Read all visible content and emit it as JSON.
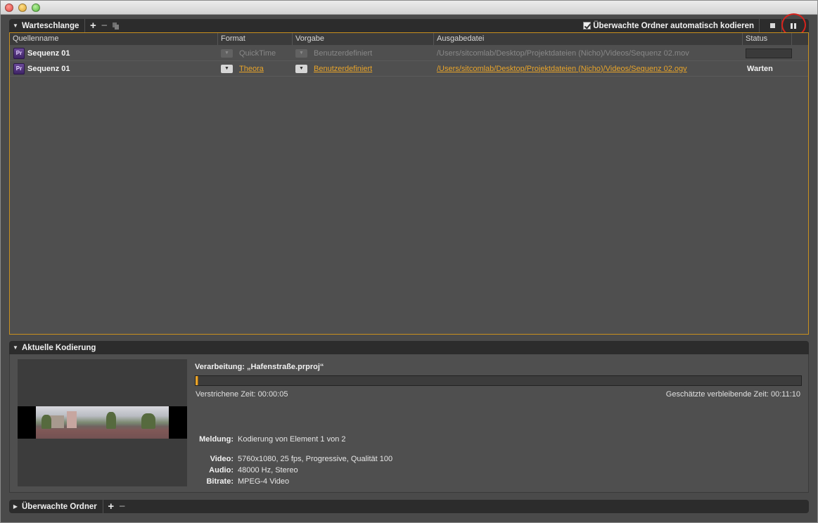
{
  "queue": {
    "title": "Warteschlange",
    "auto_encode_label": "Überwachte Ordner automatisch kodieren",
    "auto_encode_checked": true,
    "columns": [
      "Quellenname",
      "Format",
      "Vorgabe",
      "Ausgabedatei",
      "Status"
    ],
    "rows": [
      {
        "icon": "Pr",
        "source": "Sequenz 01",
        "format": "QuickTime",
        "preset": "Benutzerdefiniert",
        "output": "/Users/sitcomlab/Desktop/Projektdateien (Nicho)/Videos/Sequenz 02.mov",
        "status": ""
      },
      {
        "icon": "Pr",
        "source": "Sequenz 01",
        "format": "Theora",
        "preset": "Benutzerdefiniert",
        "output": "/Users/sitcomlab/Desktop/Projektdateien (Nicho)/Videos/Sequenz 02.ogv",
        "status": "Warten"
      }
    ]
  },
  "encoding": {
    "title": "Aktuelle Kodierung",
    "processing": "Verarbeitung: „Hafenstraße.prproj“",
    "progress_percent": 0.5,
    "elapsed": "Verstrichene Zeit: 00:00:05",
    "remaining": "Geschätzte verbleibende Zeit: 00:11:10",
    "message_label": "Meldung:",
    "message_value": "Kodierung von Element 1 von 2",
    "video_label": "Video:",
    "video_value": "5760x1080, 25 fps, Progressive, Qualität 100",
    "audio_label": "Audio:",
    "audio_value": "48000 Hz, Stereo",
    "bitrate_label": "Bitrate:",
    "bitrate_value": "MPEG-4 Video"
  },
  "watch_folders": {
    "title": "Überwachte Ordner"
  },
  "colors": {
    "accent": "#e8a42a",
    "highlight_ring": "#d8231c"
  }
}
